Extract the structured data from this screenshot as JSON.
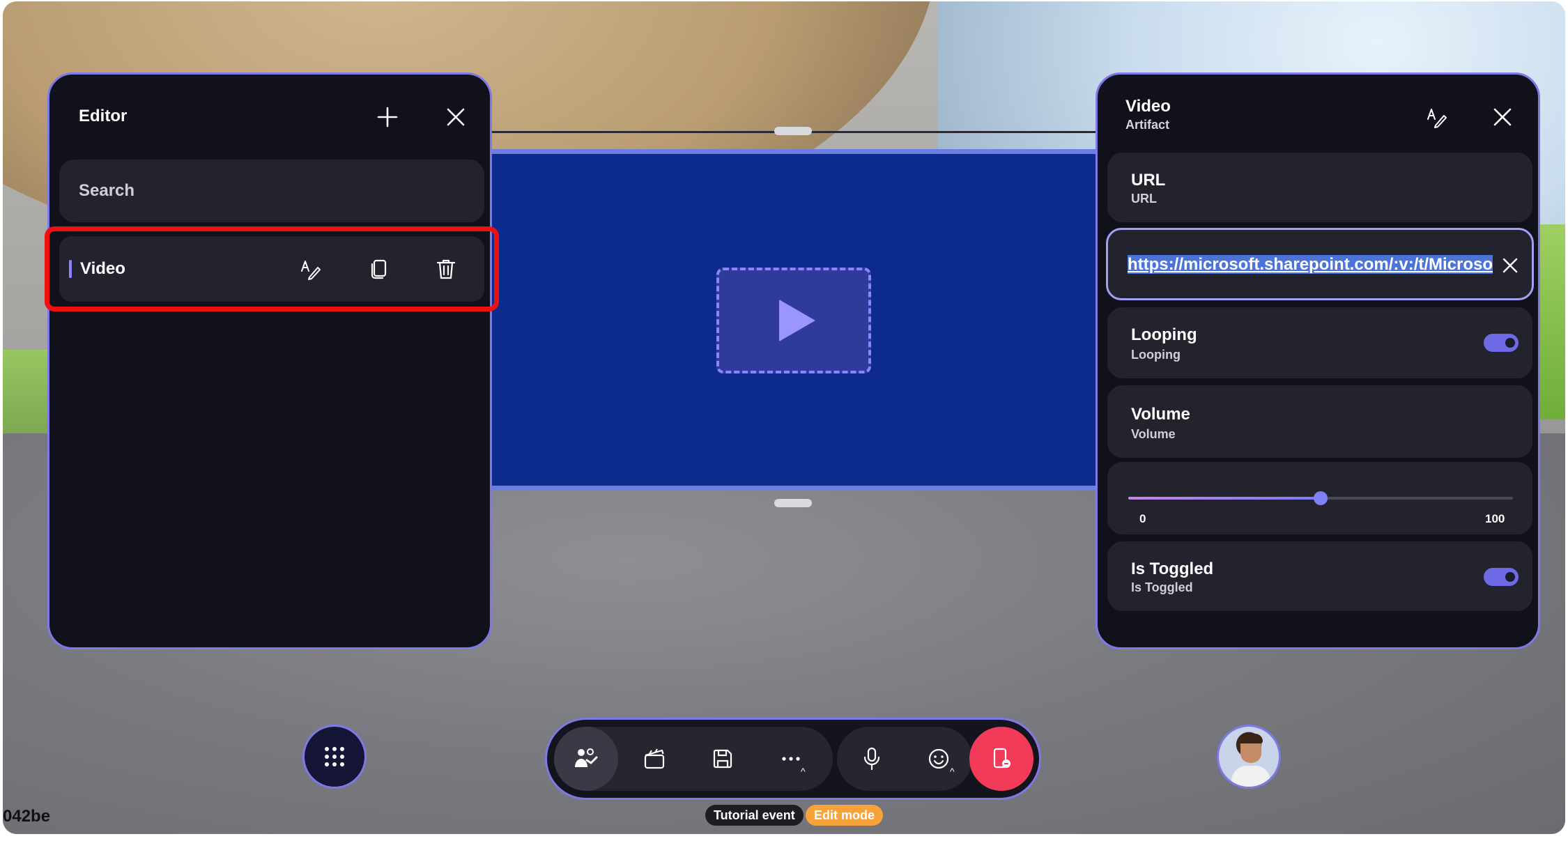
{
  "editor": {
    "title": "Editor",
    "search_placeholder": "Search",
    "items": [
      {
        "label": "Video"
      }
    ]
  },
  "properties": {
    "title": "Video",
    "subtitle": "Artifact",
    "url": {
      "title": "URL",
      "sub": "URL",
      "value": "https://microsoft.sharepoint.com/:v:/t/Microsof"
    },
    "looping": {
      "title": "Looping",
      "sub": "Looping",
      "on": true
    },
    "volume": {
      "title": "Volume",
      "sub": "Volume",
      "min": "0",
      "max": "100",
      "value": 50
    },
    "toggled": {
      "title": "Is Toggled",
      "sub": "Is Toggled",
      "on": true
    }
  },
  "toolbar": {
    "buttons": [
      "people-icon",
      "clapperboard-icon",
      "save-icon",
      "more-icon",
      "microphone-icon",
      "emoji-icon",
      "leave-icon"
    ]
  },
  "status": {
    "event_badge": "Tutorial event",
    "mode_badge": "Edit mode",
    "corner_id": "042be"
  },
  "colors": {
    "accent": "#7d7ae6",
    "highlight": "#ee1111",
    "leave": "#f23b58",
    "edit_mode": "#f7a23a",
    "screen": "#0d2b8c"
  }
}
